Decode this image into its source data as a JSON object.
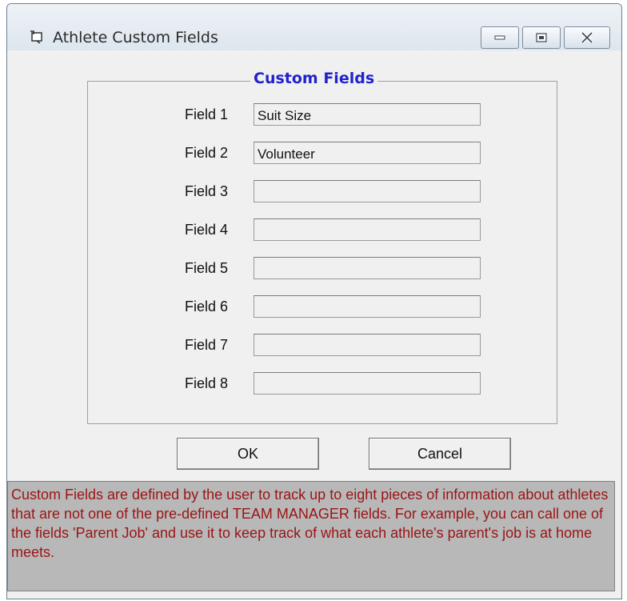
{
  "window": {
    "title": "Athlete Custom Fields",
    "icon": "window-app-icon"
  },
  "group": {
    "title": "Custom Fields"
  },
  "fields": [
    {
      "label": "Field 1",
      "value": "Suit Size"
    },
    {
      "label": "Field 2",
      "value": "Volunteer"
    },
    {
      "label": "Field 3",
      "value": ""
    },
    {
      "label": "Field 4",
      "value": ""
    },
    {
      "label": "Field 5",
      "value": ""
    },
    {
      "label": "Field 6",
      "value": ""
    },
    {
      "label": "Field 7",
      "value": ""
    },
    {
      "label": "Field 8",
      "value": ""
    }
  ],
  "buttons": {
    "ok": "OK",
    "cancel": "Cancel"
  },
  "info": {
    "text": "Custom Fields are defined by the user to track up to eight pieces of information about athletes that are not one of the pre-defined TEAM MANAGER fields. For example, you can call one of the fields 'Parent Job' and use it to keep track of what each athlete's parent's job is at home meets."
  },
  "colors": {
    "group_title": "#2222cc",
    "info_text": "#9b1414",
    "info_bg": "#b8b8b8"
  }
}
